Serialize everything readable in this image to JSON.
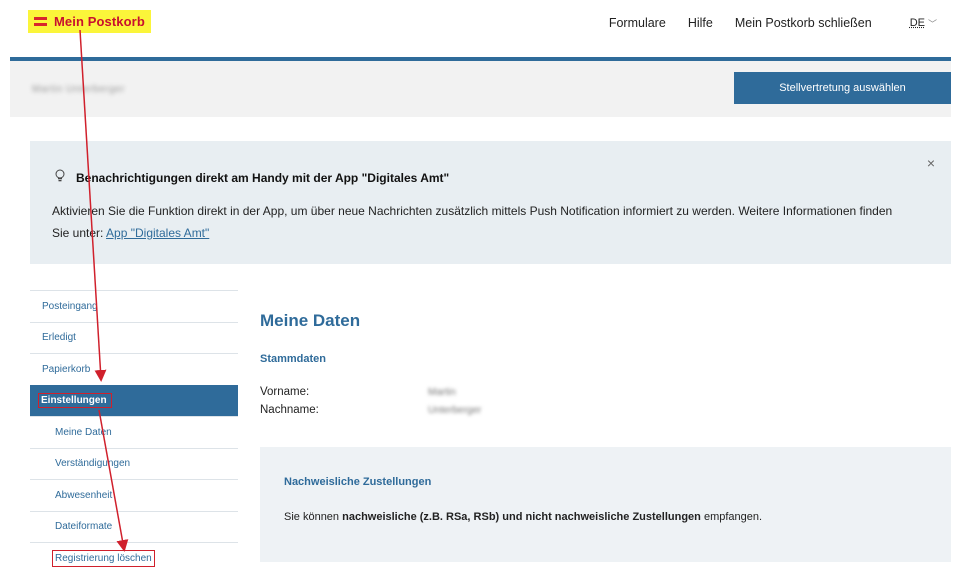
{
  "header": {
    "brand": "Mein Postkorb",
    "nav": [
      "Formulare",
      "Hilfe",
      "Mein Postkorb schließen"
    ],
    "language": "DE",
    "icons": {
      "lang_dropdown": "chevron-down-icon",
      "brand": "austrian-flag-icon"
    }
  },
  "userbar": {
    "user_name": "Martin Unterberger",
    "deputy_button": "Stellvertretung auswählen"
  },
  "notice": {
    "title": "Benachrichtigungen direkt am Handy mit der App \"Digitales Amt\"",
    "body_prefix": "Aktivieren Sie die Funktion direkt in der App, um über neue Nachrichten zusätzlich mittels Push Notification informiert zu werden. Weitere Informationen finden Sie unter: ",
    "link_text": "App \"Digitales Amt\"",
    "close": "×"
  },
  "sidebar": {
    "items": [
      {
        "label": "Posteingang"
      },
      {
        "label": "Erledigt"
      },
      {
        "label": "Papierkorb"
      },
      {
        "label": "Einstellungen"
      },
      {
        "label": "Meine Daten"
      },
      {
        "label": "Verständigungen"
      },
      {
        "label": "Abwesenheit"
      },
      {
        "label": "Dateiformate"
      },
      {
        "label": "Registrierung löschen"
      }
    ]
  },
  "main": {
    "title": "Meine Daten",
    "section": "Stammdaten",
    "fields": [
      {
        "label": "Vorname:",
        "value": "Martin"
      },
      {
        "label": "Nachname:",
        "value": "Unterberger"
      }
    ],
    "card": {
      "title": "Nachweisliche Zustellungen",
      "text_1": "Sie können ",
      "text_bold": "nachweisliche (z.B. RSa, RSb) und nicht nachweisliche Zustellungen",
      "text_2": " empfangen."
    }
  },
  "colors": {
    "accent": "#2f6b9a",
    "highlight_yellow": "#fbf53a",
    "annotation_red": "#d0202c",
    "notice_bg": "#e8eef2"
  }
}
